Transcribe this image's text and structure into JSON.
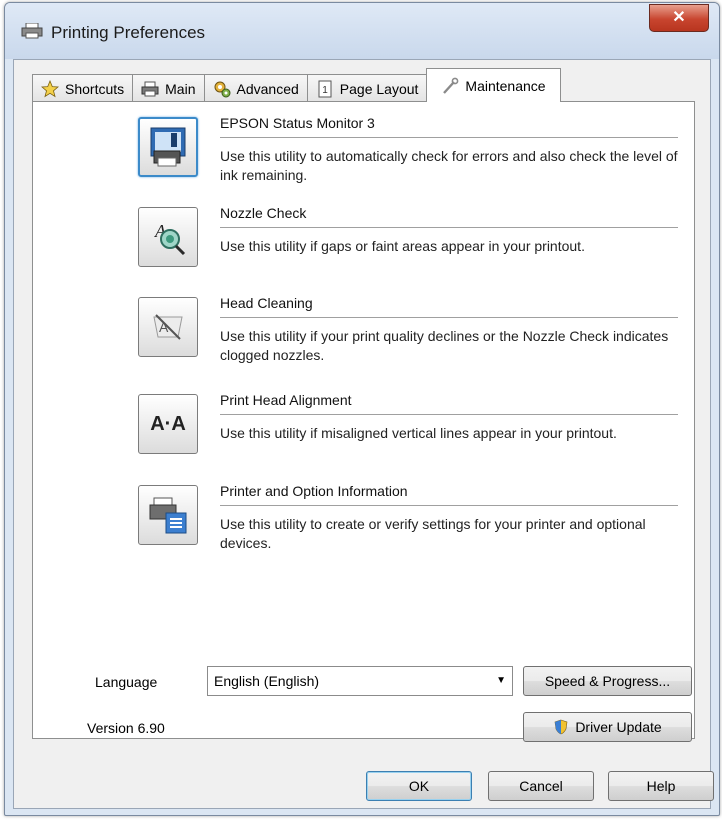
{
  "window": {
    "title": "Printing Preferences",
    "close_glyph": "✕"
  },
  "tabs": [
    {
      "label": "Shortcuts",
      "icon": "star-icon"
    },
    {
      "label": "Main",
      "icon": "printer-icon"
    },
    {
      "label": "Advanced",
      "icon": "gears-icon"
    },
    {
      "label": "Page Layout",
      "icon": "page-icon"
    },
    {
      "label": "Maintenance",
      "icon": "wrench-icon",
      "active": true
    }
  ],
  "utilities": [
    {
      "title": "EPSON Status Monitor 3",
      "description": "Use this utility to automatically check for errors and also check the level of ink remaining.",
      "icon": "status-monitor-icon"
    },
    {
      "title": "Nozzle Check",
      "description": "Use this utility if gaps or faint areas appear in your printout.",
      "icon": "nozzle-check-icon"
    },
    {
      "title": "Head Cleaning",
      "description": "Use this utility if your print quality declines or the Nozzle Check indicates clogged nozzles.",
      "icon": "head-cleaning-icon"
    },
    {
      "title": "Print Head Alignment",
      "description": "Use this utility if misaligned vertical lines appear in your printout.",
      "icon": "alignment-icon",
      "icon_text": "A·A"
    },
    {
      "title": "Printer and Option Information",
      "description": "Use this utility to create or verify settings for your printer and optional devices.",
      "icon": "printer-info-icon"
    }
  ],
  "language": {
    "label": "Language",
    "value": "English (English)"
  },
  "buttons": {
    "speed_progress": "Speed & Progress...",
    "driver_update": "Driver Update",
    "ok": "OK",
    "cancel": "Cancel",
    "help": "Help"
  },
  "version": "Version 6.90",
  "colors": {
    "accent": "#3b8ac9",
    "close": "#c8452f"
  }
}
